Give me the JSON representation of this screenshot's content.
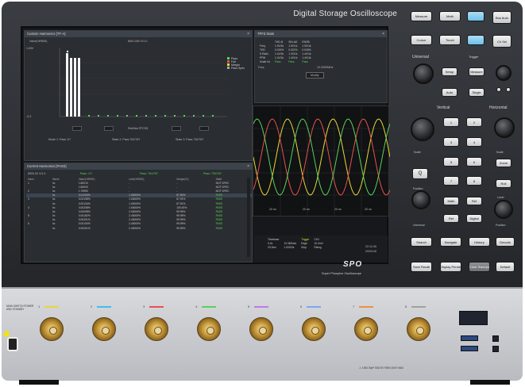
{
  "device": {
    "title": "Digital Storage Oscilloscope",
    "brand": "SPO",
    "brand_subtitle": "Super Phosphor Oscilloscope"
  },
  "screen": {
    "hist_panel": {
      "title": "Custom Harmonics [TF-A]",
      "close": "×",
      "y_title": "Value(%RMS)",
      "y_top": "1.00V",
      "y_bottom": "-0.3",
      "top_label": "8001.000 V/1.0",
      "legend": [
        "Pass",
        "Fail",
        "Margin",
        "Pass Spec"
      ],
      "center_button": "Rel/Abs RTCS5",
      "status": [
        "Mode 1: Pass 1/7",
        "State 2: Pass 761/767",
        "State 3: Pass 730/767"
      ]
    },
    "meas_panel": {
      "title": "TPFd Stats",
      "close": "×",
      "cols": [
        "",
        "THD-N",
        "SIN-AD",
        "ENOB"
      ],
      "rows": [
        [
          "Freq",
          "1.9V/1k",
          "1.9V/1k",
          "1.9V/1k"
        ],
        [
          "THD",
          "0.019%",
          "0.022%",
          "0.018%"
        ],
        [
          "S.Ratio",
          "1.4V/1k",
          "1.4V/1k",
          "1.4V/1k"
        ],
        [
          "PPM",
          "1.4V/1k",
          "1.4V/1k",
          "1.4V/1k"
        ],
        [
          "Scale.Vo",
          "Pass",
          "Pass",
          "Pass"
        ]
      ],
      "freq_label": "Freq",
      "freq_value": "10.0000MHz",
      "button": "Modify"
    },
    "table_panel": {
      "title": "Current Harmonics [PASS]",
      "close": "×",
      "subhead": [
        "8000.00 V/1.0",
        "Pass: 1/7",
        "Pass: 761/767",
        "Pass: 730/767"
      ],
      "headers": [
        "Harm",
        "Name",
        "Value(%RMS)",
        "Limit(%RMS)",
        "Margin(%)",
        "State"
      ],
      "rows": [
        [
          "1",
          "hc",
          "1.8001V",
          "-",
          "-",
          "NOT SPEC"
        ],
        [
          "",
          "hc",
          "1.8000V",
          "-",
          "-",
          "NOT SPEC"
        ],
        [
          "2",
          "hc",
          "1.7999V",
          "-",
          "-",
          "NOT SPEC"
        ],
        [
          "",
          "hc",
          "0.01200%",
          "1.00000%",
          "87.90%",
          "PASS"
        ],
        [
          "3",
          "hc",
          "0.00198%",
          "1.00000%",
          "87.91%",
          "PASS"
        ],
        [
          "",
          "hc",
          "0.00134%",
          "1.00000%",
          "87.91%",
          "PASS"
        ],
        [
          "4",
          "hc",
          "0.00208%",
          "1.00000%",
          "100.00%",
          "PASS"
        ],
        [
          "",
          "hc",
          "0.00098%",
          "2.00000%",
          "99.99%",
          "PASS"
        ],
        [
          "5",
          "hc",
          "0.00182%",
          "2.40000%",
          "99.99%",
          "PASS"
        ],
        [
          "",
          "hc",
          "0.00201%",
          "2.40000%",
          "99.99%",
          "PASS"
        ],
        [
          "6",
          "hc",
          "0.00100%",
          "2.40000%",
          "99.99%",
          "PASS"
        ],
        [
          "",
          "hc",
          "0.00201%",
          "2.40000%",
          "99.99%",
          "PASS"
        ]
      ]
    },
    "status": {
      "rows": [
        [
          "Timebase",
          "",
          "Trigger",
          "CH1"
        ],
        [
          "0.0s",
          "10.0MSa/s",
          "Edge",
          "10.0mV"
        ],
        [
          "20.0ms",
          "1.00GSa",
          "Stop",
          "Rising"
        ]
      ],
      "time": "22:12:45",
      "date": "2020/1/6",
      "x_labels": [
        "20 ns",
        "20 ns",
        "20 ns",
        "20 ns"
      ]
    }
  },
  "controls": {
    "top_buttons": [
      "Measure",
      "Math",
      "Cursor",
      "Decode",
      "Touch",
      "",
      "Ch Sel"
    ],
    "top_buttons_right": [
      "Bus Auto",
      "Trigger"
    ],
    "sections": {
      "universal": "Universal",
      "vertical": "Vertical",
      "horizontal": "Horizontal",
      "trigger": "Trigger"
    },
    "mid_buttons": [
      "Setup",
      "Auto",
      "Single",
      "Measure"
    ],
    "multi_btn_labels": [
      "Run Stop",
      "Mode"
    ],
    "ch_buttons": [
      "1",
      "2",
      "3",
      "4",
      "5",
      "6",
      "7",
      "8"
    ],
    "search": "Q",
    "math_buttons": [
      "Math",
      "Ref",
      "Digital",
      "Zoom"
    ],
    "knob_labels": [
      "Position",
      "Scale",
      "Position",
      "Scale",
      "Level",
      "Universal"
    ],
    "bottom_row1": [
      "Search",
      "Navigate",
      "History",
      "Decode"
    ],
    "bottom_row2": [
      "Save Recall",
      "Display Persist",
      "Clear Sweeps",
      "Default"
    ],
    "right_labels": [
      "Zoom",
      "Roll"
    ]
  },
  "front": {
    "power_label": "MAIN SWITCH POWER AND STANDBY",
    "channels": [
      "1",
      "2",
      "3",
      "4",
      "5",
      "6",
      "7",
      "8"
    ],
    "channel_colors": [
      "#e8d838",
      "#3cc0f0",
      "#e85050",
      "#5cd05c",
      "#c07ae8",
      "#7aa8f0",
      "#f09040",
      "#a0a0a0"
    ],
    "warning": "⚠ 1MΩ 30pF  50Ω  5V RMS  400V MAX"
  },
  "colors": {
    "pass": "#5bd65b",
    "trace1": "#e8d838",
    "trace2": "#e85050",
    "trace3": "#5cd05c"
  }
}
